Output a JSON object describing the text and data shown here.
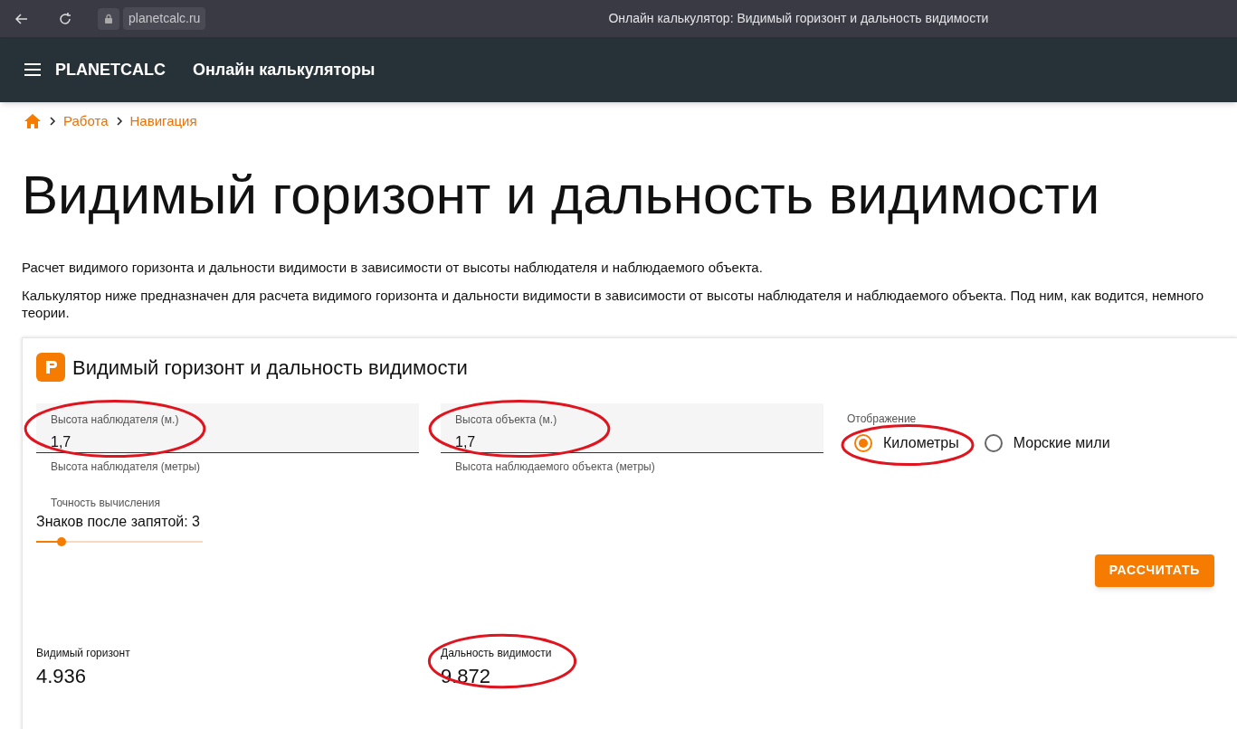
{
  "browser": {
    "address": "planetcalc.ru",
    "tab_title": "Онлайн калькулятор: Видимый горизонт и дальность видимости"
  },
  "header": {
    "logo": "PLANETCALC",
    "title": "Онлайн калькуляторы"
  },
  "breadcrumbs": [
    "Работа",
    "Навигация"
  ],
  "page_title": "Видимый горизонт и дальность видимости",
  "paragraphs": [
    "Расчет видимого горизонта и дальности видимости в зависимости от высоты наблюдателя и наблюдаемого объекта.",
    "Калькулятор ниже предназначен для расчета видимого горизонта и дальности видимости в зависимости от высоты наблюдателя и наблюдаемого объекта. Под ним, как водится, немного теории."
  ],
  "calculator": {
    "title": "Видимый горизонт и дальность видимости",
    "fields": [
      {
        "label": "Высота наблюдателя (м.)",
        "value": "1,7",
        "hint": "Высота наблюдателя (метры)",
        "circled": true
      },
      {
        "label": "Высота объекта (м.)",
        "value": "1,7",
        "hint": "Высота наблюдаемого объекта (метры)",
        "circled": true
      }
    ],
    "display": {
      "label": "Отображение",
      "options": [
        {
          "label": "Километры",
          "selected": true,
          "circled": true
        },
        {
          "label": "Морские мили",
          "selected": false,
          "circled": false
        }
      ]
    },
    "precision": {
      "label": "Точность вычисления",
      "value": "Знаков после запятой: 3",
      "level": 0.15
    },
    "button": "РАССЧИТАТЬ",
    "results": [
      {
        "label": "Видимый горизонт",
        "value": "4.936",
        "circled": false
      },
      {
        "label": "Дальность видимости",
        "value": "9.872",
        "circled": true
      }
    ]
  }
}
